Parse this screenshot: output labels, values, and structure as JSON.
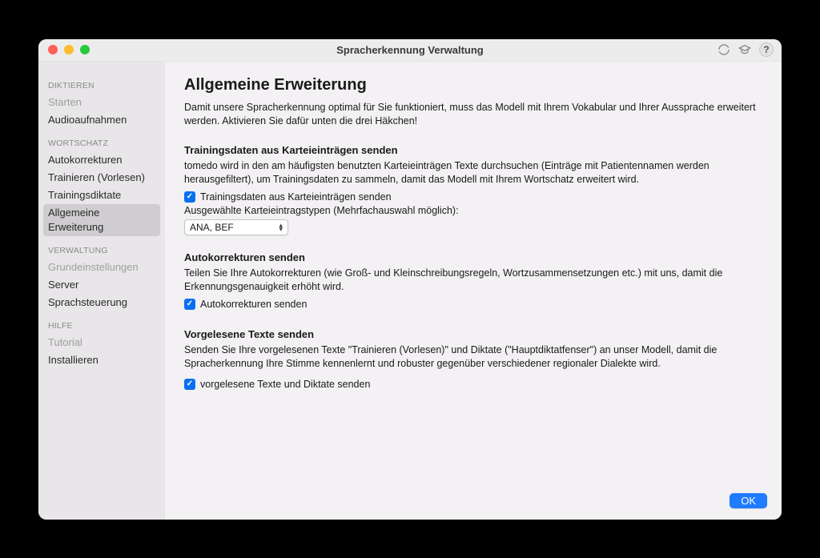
{
  "window": {
    "title": "Spracherkennung Verwaltung"
  },
  "sidebar": {
    "sections": [
      {
        "title": "DIKTIEREN",
        "items": [
          {
            "label": "Starten",
            "disabled": true
          },
          {
            "label": "Audioaufnahmen",
            "disabled": false
          }
        ]
      },
      {
        "title": "WORTSCHATZ",
        "items": [
          {
            "label": "Autokorrekturen"
          },
          {
            "label": "Trainieren (Vorlesen)"
          },
          {
            "label": "Trainingsdiktate"
          },
          {
            "label": "Allgemeine Erweiterung",
            "selected": true
          }
        ]
      },
      {
        "title": "VERWALTUNG",
        "items": [
          {
            "label": "Grundeinstellungen",
            "disabled": true
          },
          {
            "label": "Server"
          },
          {
            "label": "Sprachsteuerung"
          }
        ]
      },
      {
        "title": "HILFE",
        "items": [
          {
            "label": "Tutorial",
            "disabled": true
          },
          {
            "label": "Installieren"
          }
        ]
      }
    ]
  },
  "main": {
    "heading": "Allgemeine Erweiterung",
    "intro": "Damit unsere Spracherkennung optimal für Sie funktioniert, muss das Modell mit Ihrem Vokabular und Ihrer Aussprache erweitert  werden. Aktivieren Sie dafür unten die drei Häkchen!",
    "section1": {
      "title": "Trainingsdaten aus Karteieinträgen senden",
      "desc": "tomedo wird in den am häufigsten benutzten Karteieinträgen Texte durchsuchen (Einträge mit Patientennamen werden herausgefiltert), um Trainingsdaten zu sammeln, damit das Modell mit Ihrem Wortschatz erweitert wird.",
      "check_label": "Trainingsdaten aus Karteieinträgen senden",
      "subtext": "Ausgewählte Karteieintragstypen (Mehrfachauswahl möglich):",
      "select_value": "ANA, BEF"
    },
    "section2": {
      "title": "Autokorrekturen senden",
      "desc": "Teilen Sie Ihre Autokorrekturen (wie Groß- und Kleinschreibungsregeln, Wortzusammensetzungen etc.) mit uns, damit die Erkennungsgenauigkeit erhöht wird.",
      "check_label": "Autokorrekturen senden"
    },
    "section3": {
      "title": "Vorgelesene Texte senden",
      "desc": "Senden Sie Ihre vorgelesenen Texte \"Trainieren (Vorlesen)\" und Diktate (\"Hauptdiktatfenser\") an unser Modell, damit die Spracherkennung Ihre Stimme kennenlernt und robuster gegenüber verschiedener regionaler Dialekte wird.",
      "check_label": "vorgelesene Texte und Diktate senden"
    }
  },
  "footer": {
    "ok": "OK"
  },
  "help": {
    "q": "?"
  }
}
